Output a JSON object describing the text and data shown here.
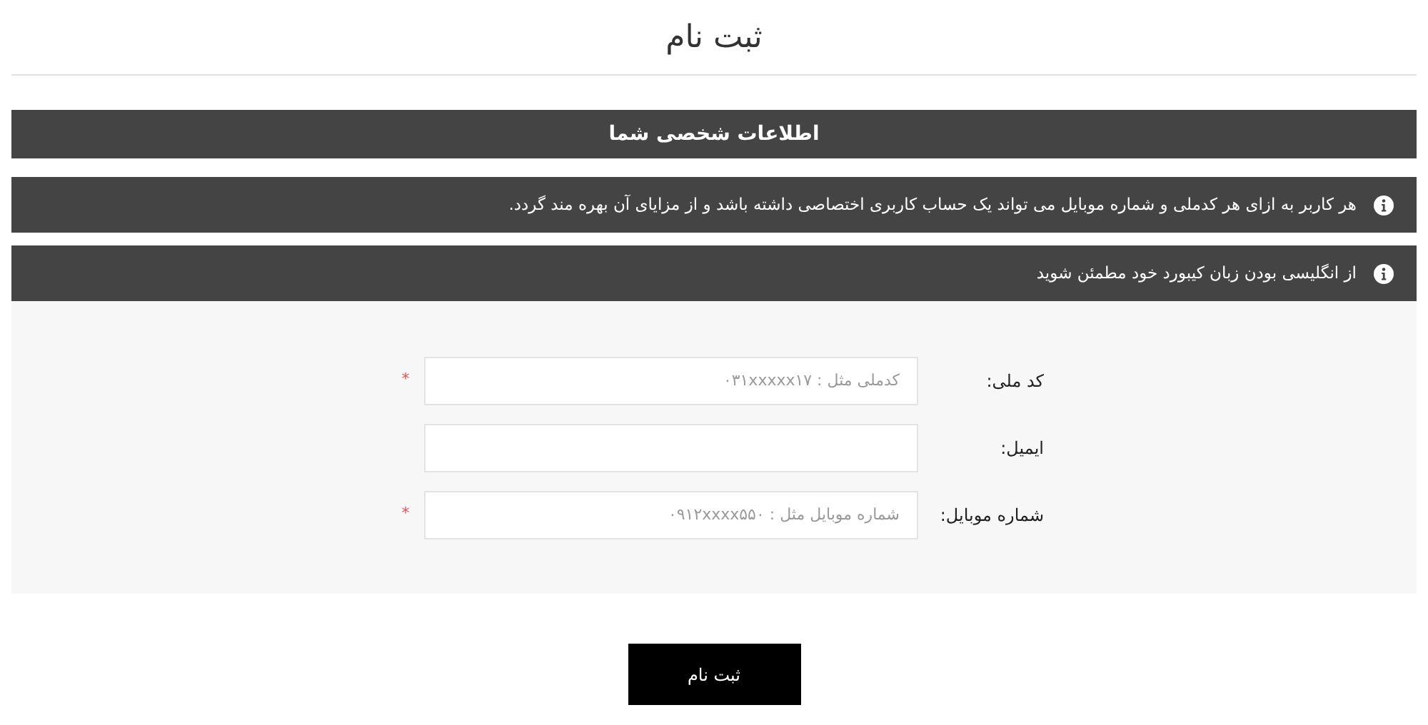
{
  "page_title": "ثبت نام",
  "section_header": "اطلاعات شخصی شما",
  "notices": [
    "هر کاربر به ازای هر کدملی و شماره موبایل می تواند یک حساب کاربری اختصاصی داشته باشد و از مزایای آن بهره مند گردد.",
    "از انگلیسی بودن زبان کیبورد خود مطمئن شوید"
  ],
  "fields": [
    {
      "label": "کد ملی:",
      "placeholder": "کدملی مثل : ۰۳۱xxxxx۱۷",
      "required_mark": "*"
    },
    {
      "label": "ایمیل:"
    },
    {
      "label": "شماره موبایل:",
      "placeholder": "شماره موبایل مثل : ۰۹۱۲xxxx۵۵۰",
      "required_mark": "*"
    }
  ],
  "submit_button": "ثبت نام"
}
